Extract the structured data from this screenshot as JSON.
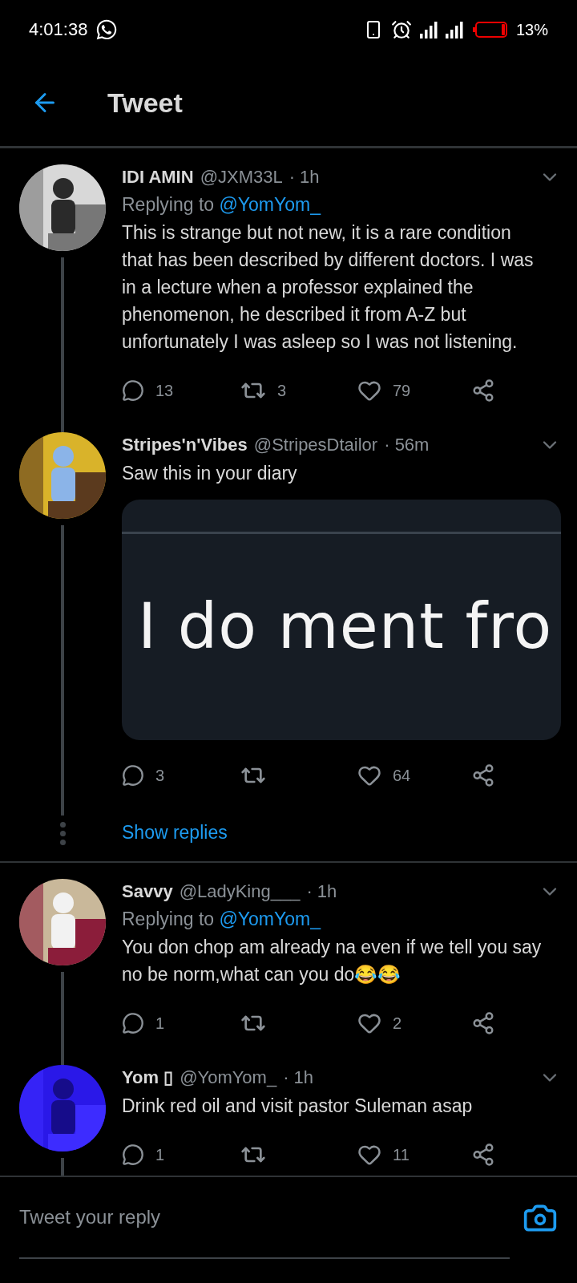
{
  "status_bar": {
    "time": "4:01:38",
    "battery": "13%"
  },
  "header": {
    "title": "Tweet"
  },
  "tweets": [
    {
      "name": "IDI AMIN",
      "handle": "@JXM33L",
      "time": "· 1h",
      "replying_label": "Replying to",
      "replying_to": "@YomYom_",
      "text": "This is strange but not new, it is a rare condition that has been described by different doctors. I was in a lecture when a professor explained the phenomenon, he described it from A-Z but unfortunately I was asleep so I was not listening.",
      "replies": "13",
      "retweets": "3",
      "likes": "79"
    },
    {
      "name": "Stripes'n'Vibes",
      "handle": "@StripesDtailor",
      "time": "· 56m",
      "text": "Saw this in your diary",
      "media_text": "I do ment fro",
      "replies": "3",
      "likes": "64",
      "show_replies": "Show replies"
    },
    {
      "name": "Savvy",
      "handle": "@LadyKing___",
      "time": "· 1h",
      "replying_label": "Replying to",
      "replying_to": "@YomYom_",
      "text": "You don chop am already na even if we tell you say no be norm,what can you do😂😂",
      "replies": "1",
      "likes": "2"
    },
    {
      "name": "Yom ▯",
      "handle": "@YomYom_",
      "time": "· 1h",
      "text": "Drink red oil and visit pastor Suleman asap",
      "replies": "1",
      "likes": "11"
    }
  ],
  "composer": {
    "placeholder": "Tweet your reply"
  }
}
